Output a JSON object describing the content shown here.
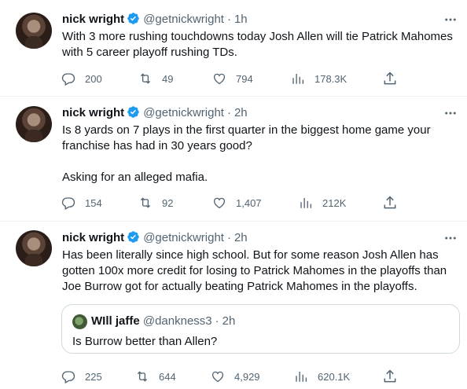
{
  "colors": {
    "text": "#0f1419",
    "muted": "#536471",
    "verified": "#1d9bf0",
    "divider": "#eff3f4"
  },
  "tweets": [
    {
      "author": "nick wright",
      "handle": "@getnickwright",
      "separator": "·",
      "time": "1h",
      "text": "With 3 more rushing touchdowns today Josh Allen will tie Patrick Mahomes\nwith 5 career playoff rushing TDs.",
      "replies": "200",
      "retweets": "49",
      "likes": "794",
      "views": "178.3K"
    },
    {
      "author": "nick wright",
      "handle": "@getnickwright",
      "separator": "·",
      "time": "2h",
      "text": "Is 8 yards on 7 plays in the first quarter in the biggest home game your\nfranchise has had in 30 years good?\n\nAsking for an alleged mafia.",
      "replies": "154",
      "retweets": "92",
      "likes": "1,407",
      "views": "212K"
    },
    {
      "author": "nick wright",
      "handle": "@getnickwright",
      "separator": "·",
      "time": "2h",
      "text": "Has been literally since high school. But for some reason Josh Allen has\ngotten 100x more credit for losing to Patrick Mahomes in the playoffs than\nJoe Burrow got for actually beating Patrick Mahomes in the playoffs.",
      "quote": {
        "author": "WIll jaffe",
        "handle": "@dankness3",
        "separator": "·",
        "time": "2h",
        "text": "Is Burrow better than Allen?"
      },
      "replies": "225",
      "retweets": "644",
      "likes": "4,929",
      "views": "620.1K"
    }
  ],
  "icons": [
    "avatar",
    "verified-badge-icon",
    "more-icon",
    "reply-icon",
    "retweet-icon",
    "like-icon",
    "views-icon",
    "share-icon"
  ]
}
